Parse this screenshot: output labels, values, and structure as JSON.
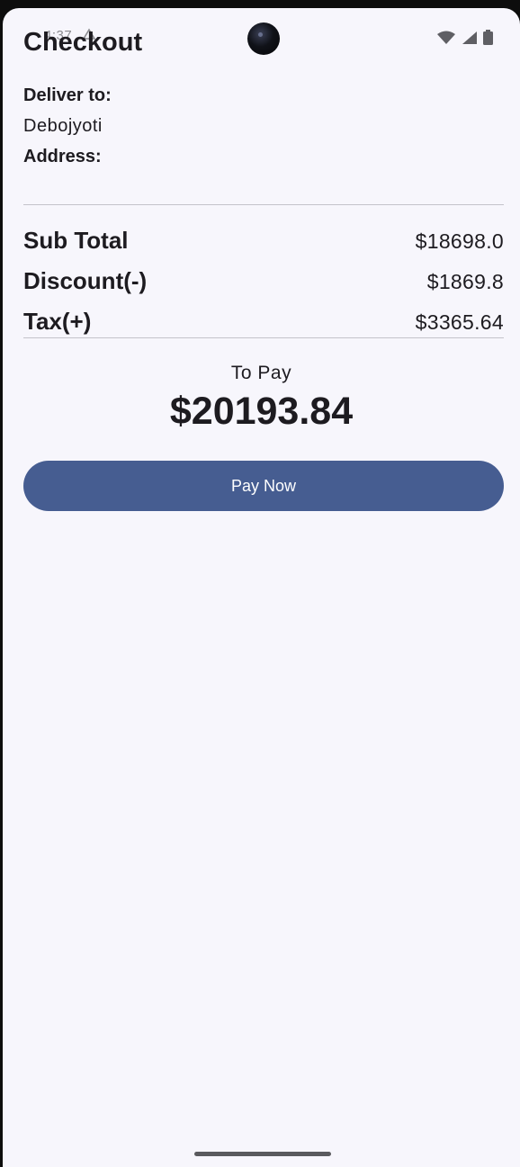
{
  "status_bar": {
    "time": "4:37",
    "icons": [
      "wifi-icon",
      "signal-icon",
      "battery-icon"
    ]
  },
  "header": {
    "title": "Checkout"
  },
  "delivery": {
    "deliver_to_label": "Deliver to:",
    "name": "Debojyoti",
    "address_label": "Address:"
  },
  "summary": {
    "rows": [
      {
        "label": "Sub Total",
        "value": "$18698.0"
      },
      {
        "label": "Discount(-)",
        "value": "$1869.8"
      },
      {
        "label": "Tax(+)",
        "value": "$3365.64"
      }
    ]
  },
  "total": {
    "label": "To Pay",
    "amount": "$20193.84"
  },
  "actions": {
    "pay_label": "Pay Now"
  },
  "colors": {
    "background": "#f7f6fc",
    "primary_button": "#465d91",
    "text": "#1d1b20",
    "divider": "#c4c3ca"
  }
}
